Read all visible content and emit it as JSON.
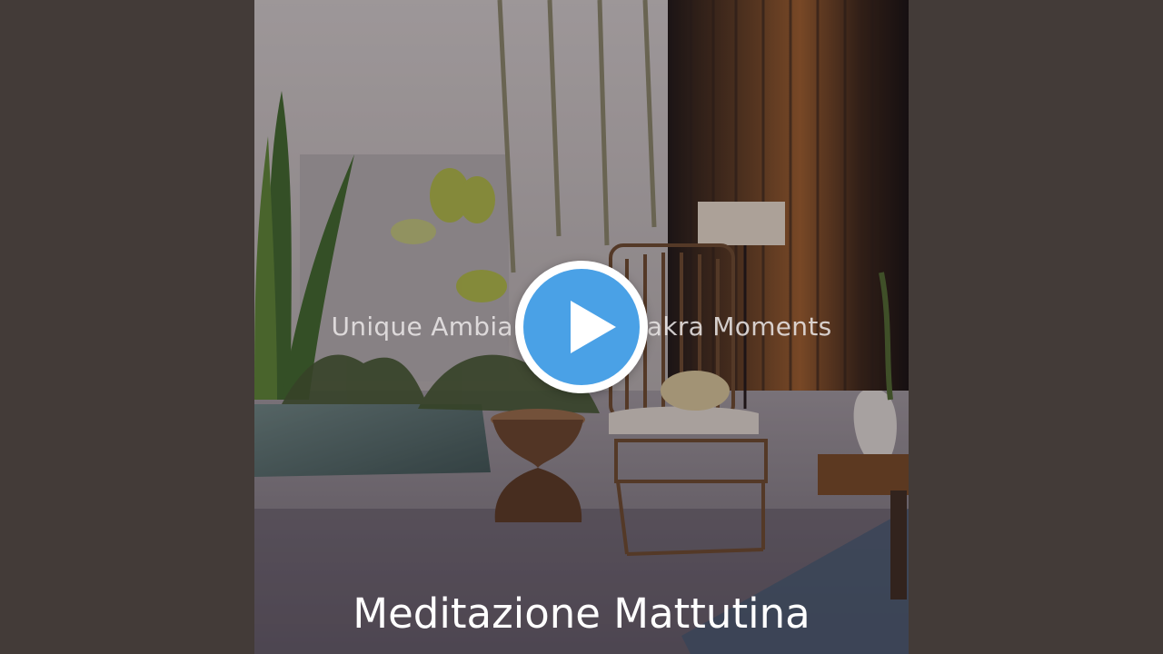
{
  "video": {
    "subtitle": "Unique Ambiance for Chakra Moments",
    "track_title": "Meditazione Mattutina",
    "play_button_icon": "play-icon"
  },
  "colors": {
    "letterbox": "#433b38",
    "play_accent": "#4aa1e6",
    "text": "#ffffff"
  }
}
